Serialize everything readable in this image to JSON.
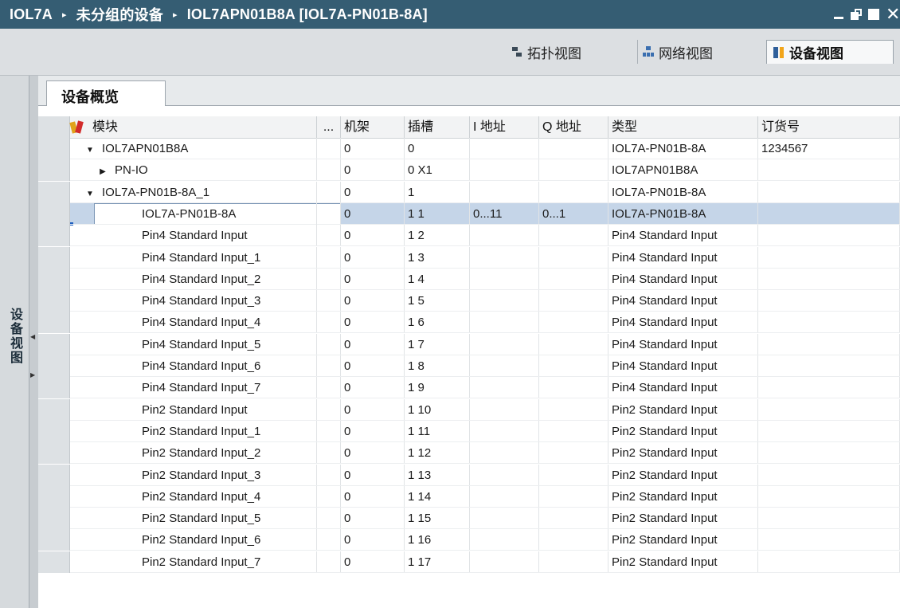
{
  "titlebar": {
    "crumbs": [
      "IOL7A",
      "未分组的设备",
      "IOL7APN01B8A [IOL7A-PN01B-8A]"
    ],
    "separator": "▸"
  },
  "toolbar": {
    "topology_view": "拓扑视图",
    "network_view": "网络视图",
    "device_view": "设备视图"
  },
  "side_tab": {
    "label": "设备视图"
  },
  "content": {
    "tab_overview": "设备概览"
  },
  "table": {
    "headers": {
      "module": "模块",
      "dots": "...",
      "rack": "机架",
      "slot": "插槽",
      "i_addr": "I 地址",
      "q_addr": "Q 地址",
      "type": "类型",
      "order_no": "订货号"
    },
    "rows": [
      {
        "module": "IOL7APN01B8A",
        "level": 0,
        "toggle": "▼",
        "rack": "0",
        "slot": "0",
        "i_addr": "",
        "q_addr": "",
        "type": "IOL7A-PN01B-8A",
        "order_no": "1234567"
      },
      {
        "module": "PN-IO",
        "level": 1,
        "toggle": "▶",
        "rack": "0",
        "slot": "0 X1",
        "i_addr": "",
        "q_addr": "",
        "type": "IOL7APN01B8A",
        "order_no": ""
      },
      {
        "module": "IOL7A-PN01B-8A_1",
        "level": 0,
        "toggle": "▼",
        "rack": "0",
        "slot": "1",
        "i_addr": "",
        "q_addr": "",
        "type": "IOL7A-PN01B-8A",
        "order_no": ""
      },
      {
        "module": "IOL7A-PN01B-8A",
        "level": 2,
        "toggle": "",
        "rack": "0",
        "slot": "1 1",
        "i_addr": "0...11",
        "q_addr": "0...1",
        "type": "IOL7A-PN01B-8A",
        "order_no": "",
        "selected": true
      },
      {
        "module": "Pin4 Standard Input",
        "level": 2,
        "toggle": "",
        "rack": "0",
        "slot": "1 2",
        "i_addr": "",
        "q_addr": "",
        "type": "Pin4 Standard Input",
        "order_no": ""
      },
      {
        "module": "Pin4 Standard Input_1",
        "level": 2,
        "toggle": "",
        "rack": "0",
        "slot": "1 3",
        "i_addr": "",
        "q_addr": "",
        "type": "Pin4 Standard Input",
        "order_no": ""
      },
      {
        "module": "Pin4 Standard Input_2",
        "level": 2,
        "toggle": "",
        "rack": "0",
        "slot": "1 4",
        "i_addr": "",
        "q_addr": "",
        "type": "Pin4 Standard Input",
        "order_no": ""
      },
      {
        "module": "Pin4 Standard Input_3",
        "level": 2,
        "toggle": "",
        "rack": "0",
        "slot": "1 5",
        "i_addr": "",
        "q_addr": "",
        "type": "Pin4 Standard Input",
        "order_no": ""
      },
      {
        "module": "Pin4 Standard Input_4",
        "level": 2,
        "toggle": "",
        "rack": "0",
        "slot": "1 6",
        "i_addr": "",
        "q_addr": "",
        "type": "Pin4 Standard Input",
        "order_no": ""
      },
      {
        "module": "Pin4 Standard Input_5",
        "level": 2,
        "toggle": "",
        "rack": "0",
        "slot": "1 7",
        "i_addr": "",
        "q_addr": "",
        "type": "Pin4 Standard Input",
        "order_no": ""
      },
      {
        "module": "Pin4 Standard Input_6",
        "level": 2,
        "toggle": "",
        "rack": "0",
        "slot": "1 8",
        "i_addr": "",
        "q_addr": "",
        "type": "Pin4 Standard Input",
        "order_no": ""
      },
      {
        "module": "Pin4 Standard Input_7",
        "level": 2,
        "toggle": "",
        "rack": "0",
        "slot": "1 9",
        "i_addr": "",
        "q_addr": "",
        "type": "Pin4 Standard Input",
        "order_no": ""
      },
      {
        "module": "Pin2 Standard Input",
        "level": 2,
        "toggle": "",
        "rack": "0",
        "slot": "1 10",
        "i_addr": "",
        "q_addr": "",
        "type": "Pin2 Standard Input",
        "order_no": ""
      },
      {
        "module": "Pin2 Standard Input_1",
        "level": 2,
        "toggle": "",
        "rack": "0",
        "slot": "1 11",
        "i_addr": "",
        "q_addr": "",
        "type": "Pin2 Standard Input",
        "order_no": ""
      },
      {
        "module": "Pin2 Standard Input_2",
        "level": 2,
        "toggle": "",
        "rack": "0",
        "slot": "1 12",
        "i_addr": "",
        "q_addr": "",
        "type": "Pin2 Standard Input",
        "order_no": ""
      },
      {
        "module": "Pin2 Standard Input_3",
        "level": 2,
        "toggle": "",
        "rack": "0",
        "slot": "1 13",
        "i_addr": "",
        "q_addr": "",
        "type": "Pin2 Standard Input",
        "order_no": ""
      },
      {
        "module": "Pin2 Standard Input_4",
        "level": 2,
        "toggle": "",
        "rack": "0",
        "slot": "1 14",
        "i_addr": "",
        "q_addr": "",
        "type": "Pin2 Standard Input",
        "order_no": ""
      },
      {
        "module": "Pin2 Standard Input_5",
        "level": 2,
        "toggle": "",
        "rack": "0",
        "slot": "1 15",
        "i_addr": "",
        "q_addr": "",
        "type": "Pin2 Standard Input",
        "order_no": ""
      },
      {
        "module": "Pin2 Standard Input_6",
        "level": 2,
        "toggle": "",
        "rack": "0",
        "slot": "1 16",
        "i_addr": "",
        "q_addr": "",
        "type": "Pin2 Standard Input",
        "order_no": ""
      },
      {
        "module": "Pin2 Standard Input_7",
        "level": 2,
        "toggle": "",
        "rack": "0",
        "slot": "1 17",
        "i_addr": "",
        "q_addr": "",
        "type": "Pin2 Standard Input",
        "order_no": ""
      }
    ]
  }
}
